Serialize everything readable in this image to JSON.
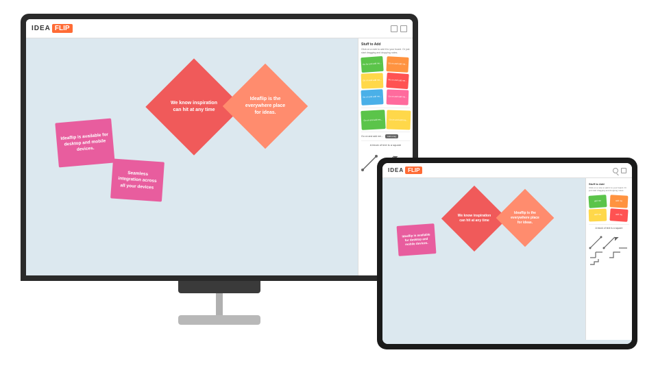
{
  "app": {
    "logo": {
      "idea": "IDEA",
      "flip": "FLIP"
    }
  },
  "desktop": {
    "canvas_notes": {
      "note1": {
        "text": "We know inspiration can hit at any time",
        "color": "#f05a5a",
        "type": "diamond"
      },
      "note2": {
        "text": "Ideaflip is the everywhere place for ideas.",
        "color": "#ff8c6e",
        "type": "diamond"
      },
      "note3": {
        "text": "Ideaflip is available for desktop and mobile devices.",
        "color": "#e85d9e",
        "type": "square"
      },
      "note4": {
        "text": "Seamless integration across all your devices",
        "color": "#e85d9e",
        "type": "square"
      }
    }
  },
  "sidebar": {
    "title": "Stuff to Add",
    "subtitle": "Click on a note to add it to your board. Or just start dragging and dropping notes.",
    "notes": [
      {
        "color": "#5bc44a",
        "text": "Go for and add me..."
      },
      {
        "color": "#ff9340",
        "text": "Go on and add me..."
      },
      {
        "color": "#ffd84a",
        "text": "Go on and add me..."
      },
      {
        "color": "#ff5252",
        "text": "Go on and add me..."
      },
      {
        "color": "#4ab0e8",
        "text": "Go on and add me..."
      },
      {
        "color": "#ff6b9d",
        "text": "Go on and add me..."
      }
    ],
    "text_block": "A block of text is a square",
    "add_text_label": "Add a text"
  },
  "tablet": {
    "canvas_notes": {
      "note1": {
        "text": "We know inspiration can hit at any time",
        "color": "#f05a5a"
      },
      "note2": {
        "text": "Ideaflip is the everywhere place for ideas.",
        "color": "#ff8c6e"
      },
      "note3": {
        "text": "Ideaflip is available for desktop and mobile devices.",
        "color": "#e85d9e"
      }
    }
  }
}
